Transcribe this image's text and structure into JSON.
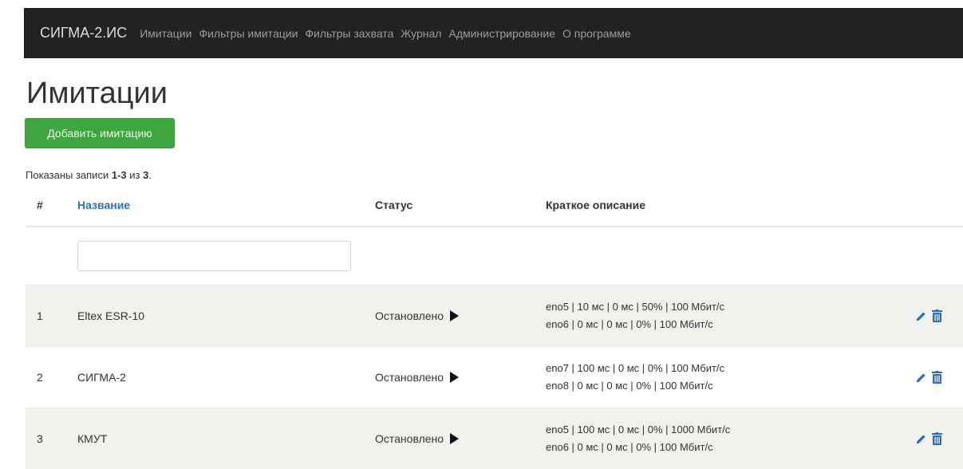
{
  "navbar": {
    "brand": "СИГМА-2.ИС",
    "items": [
      "Имитации",
      "Фильтры имитации",
      "Фильтры захвата",
      "Журнал",
      "Администрирование",
      "О программе"
    ]
  },
  "page": {
    "title": "Имитации",
    "add_button_label": "Добавить имитацию",
    "summary_prefix": "Показаны записи ",
    "summary_range": "1-3",
    "summary_mid": " из ",
    "summary_total": "3",
    "summary_suffix": "."
  },
  "table": {
    "headers": {
      "num": "#",
      "name": "Название",
      "status": "Статус",
      "description": "Краткое описание"
    },
    "filter": {
      "name_value": "",
      "name_placeholder": ""
    },
    "rows": [
      {
        "num": "1",
        "name": "Eltex ESR-10",
        "status": "Остановлено",
        "description_lines": [
          "eno5 | 10 мс | 0 мс | 50% | 100 Мбит/с",
          "eno6 | 0 мс | 0 мс | 0% | 100 Мбит/с"
        ]
      },
      {
        "num": "2",
        "name": "СИГМА-2",
        "status": "Остановлено",
        "description_lines": [
          "eno7 | 100 мс | 0 мс | 0% | 100 Мбит/с",
          "eno8 | 0 мс | 0 мс | 0% | 100 Мбит/с"
        ]
      },
      {
        "num": "3",
        "name": "КМУТ",
        "status": "Остановлено",
        "description_lines": [
          "eno5 | 100 мс | 0 мс | 0% | 1000 Мбит/с",
          "eno6 | 0 мс | 0 мс | 0% | 100 Мбит/с"
        ]
      }
    ],
    "row_icons": [
      "play-icon",
      "pencil-icon",
      "trash-icon"
    ]
  },
  "colors": {
    "navbar_bg": "#222222",
    "add_button": "#3fa63f",
    "link": "#2a6fc4",
    "action_icons": "#2a6fc4",
    "striped_row": "#f1f2ee"
  }
}
